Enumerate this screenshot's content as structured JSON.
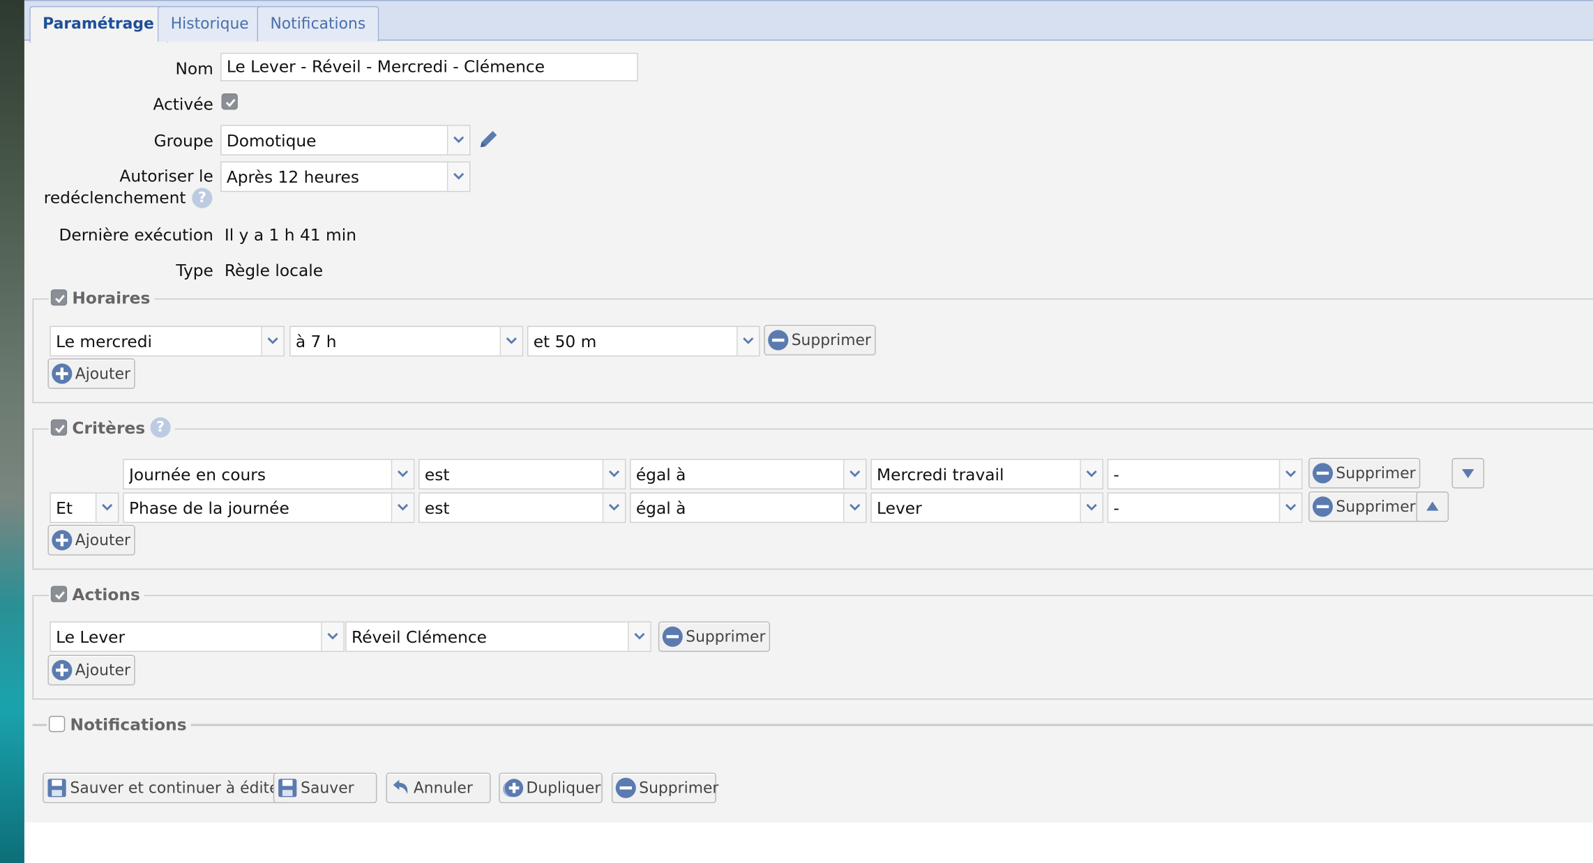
{
  "tabs": [
    {
      "label": "Paramétrage",
      "active": true
    },
    {
      "label": "Historique",
      "active": false
    },
    {
      "label": "Notifications",
      "active": false
    }
  ],
  "form": {
    "nom_label": "Nom",
    "nom_value": "Le Lever - Réveil - Mercredi - Clémence",
    "activee_label": "Activée",
    "activee_checked": true,
    "groupe_label": "Groupe",
    "groupe_value": "Domotique",
    "autoriser_label_1": "Autoriser le",
    "autoriser_label_2": "redéclenchement",
    "autoriser_value": "Après 12 heures",
    "derniere_label": "Dernière exécution",
    "derniere_value": "Il y a 1 h 41 min",
    "type_label": "Type",
    "type_value": "Règle locale"
  },
  "horaires": {
    "legend": "Horaires",
    "checked": true,
    "row": {
      "day": "Le mercredi",
      "hour": "à 7 h",
      "minute": "et 50 m"
    },
    "delete_label": "Supprimer",
    "add_label": "Ajouter"
  },
  "criteres": {
    "legend": "Critères",
    "checked": true,
    "rows": [
      {
        "connector": "",
        "subject": "Journée en cours",
        "verb": "est",
        "operator": "égal à",
        "value": "Mercredi travail",
        "extra": "-",
        "delete_label": "Supprimer"
      },
      {
        "connector": "Et",
        "subject": "Phase de la journée",
        "verb": "est",
        "operator": "égal à",
        "value": "Lever",
        "extra": "-",
        "delete_label": "Supprimer"
      }
    ],
    "add_label": "Ajouter"
  },
  "actions": {
    "legend": "Actions",
    "checked": true,
    "row": {
      "target": "Le Lever",
      "action": "Réveil Clémence"
    },
    "delete_label": "Supprimer",
    "add_label": "Ajouter"
  },
  "notifications": {
    "legend": "Notifications",
    "checked": false
  },
  "footer": {
    "save_continue_label": "Sauver et continuer à éditer",
    "save_label": "Sauver",
    "cancel_label": "Annuler",
    "duplicate_label": "Dupliquer",
    "delete_label": "Supprimer"
  },
  "colors": {
    "tab_active_text": "#1e4f9a",
    "tab_text": "#4a6fa8",
    "tabbar_bg": "#d6e0f0",
    "icon_blue": "#5b7bb0",
    "legend_text": "#666666"
  }
}
